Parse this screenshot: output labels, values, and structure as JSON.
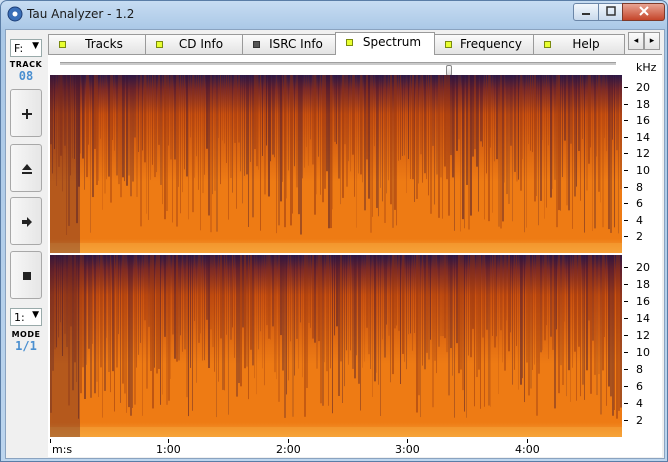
{
  "window": {
    "title": "Tau Analyzer - 1.2"
  },
  "left_toolbar": {
    "drive_select": "F:",
    "track_label": "TRACK",
    "track_value": "08",
    "mode_select": "1:",
    "mode_label": "MODE",
    "mode_value": "1/1",
    "buttons": [
      {
        "name": "add",
        "icon": "plus-icon"
      },
      {
        "name": "eject",
        "icon": "eject-icon"
      },
      {
        "name": "next",
        "icon": "arrow-right-icon"
      },
      {
        "name": "stop",
        "icon": "stop-icon"
      }
    ]
  },
  "tabs": [
    {
      "label": "Tracks",
      "led": "on"
    },
    {
      "label": "CD Info",
      "led": "on"
    },
    {
      "label": "ISRC Info",
      "led": "off"
    },
    {
      "label": "Spectrum",
      "led": "on",
      "active": true
    },
    {
      "label": "Frequency",
      "led": "on"
    },
    {
      "label": "Help",
      "led": "on"
    }
  ],
  "spectrum": {
    "y_unit": "kHz",
    "y_ticks": [
      "20",
      "18",
      "16",
      "14",
      "12",
      "10",
      "8",
      "6",
      "4",
      "2"
    ],
    "x_ticks": [
      "m:s",
      "1:00",
      "2:00",
      "3:00",
      "4:00"
    ],
    "slider_position": 0.7,
    "colors": {
      "hot": "#ee7b14",
      "mid": "#c9500f",
      "cold": "#2a1a4a",
      "band": "#f6a33a"
    }
  }
}
